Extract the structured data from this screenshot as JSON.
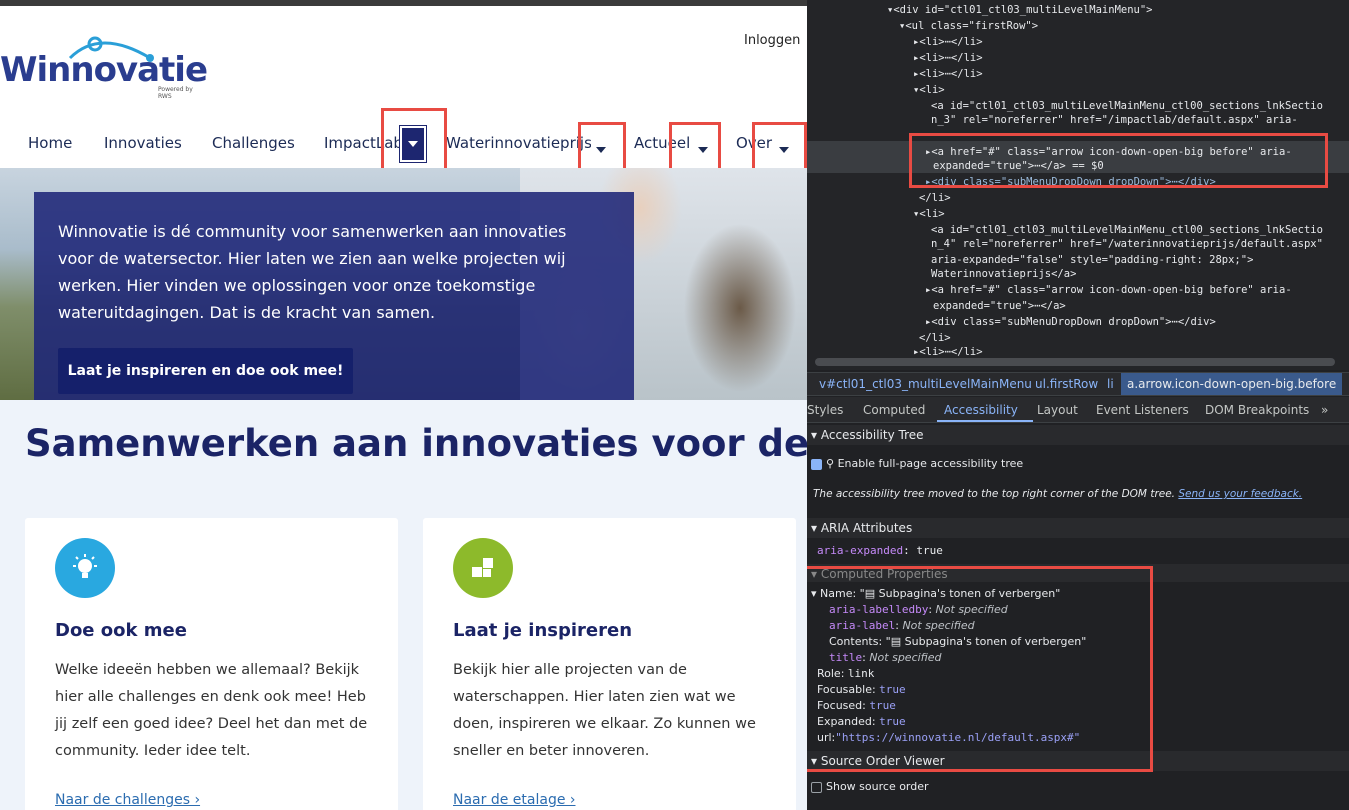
{
  "site": {
    "logo_text": "Winnovatie",
    "logo_sub": "Powered by RWS",
    "login": "Inloggen",
    "nav": [
      "Home",
      "Innovaties",
      "Challenges",
      "ImpactLab",
      "Waterinnovatieprijs",
      "Actueel",
      "Over"
    ],
    "hero_text": "Winnovatie is dé community voor samenwerken aan innovaties voor de watersector. Hier laten we zien aan welke projecten wij werken. Hier vinden we oplossingen voor onze toekomstige wateruitdagingen. Dat is de kracht van samen.",
    "hero_button": "Laat je inspireren en doe ook mee!",
    "headline": "Samenwerken aan innovaties voor de w",
    "cards": [
      {
        "title": "Doe ook mee",
        "text": "Welke ideeën hebben we allemaal? Bekijk hier alle challenges en denk ook mee! Heb jij zelf een goed idee? Deel het dan met de community. Ieder idee telt.",
        "link": "Naar de challenges ›",
        "icon": "lightbulb-icon",
        "color": "#29a8e0"
      },
      {
        "title": "Laat je inspireren",
        "text": "Bekijk hier alle projecten van de waterschappen. Hier laten zien wat we doen, inspireren we elkaar. Zo kunnen we sneller en beter innoveren.",
        "link": "Naar de etalage ›",
        "icon": "puzzle-icon",
        "color": "#8dba2b"
      }
    ]
  },
  "devtools": {
    "dom_lines": [
      {
        "t": "▾<div id=\"ctl01_ctl03_multiLevelMainMenu\">"
      },
      {
        "t": "▾<ul class=\"firstRow\">"
      },
      {
        "t": "▸<li>⋯</li>"
      },
      {
        "t": "▸<li>⋯</li>"
      },
      {
        "t": "▸<li>⋯</li>"
      },
      {
        "t": "▾<li>"
      },
      {
        "t": "<a id=\"ctl01_ctl03_multiLevelMainMenu_ctl00_sections_lnkSectio"
      },
      {
        "t": "n_3\" rel=\"noreferrer\" href=\"/impactlab/default.aspx\" aria-"
      },
      {
        "t": "▸<a href=\"#\" class=\"arrow icon-down-open-big before\" aria-"
      },
      {
        "t": "expanded=\"true\">⋯</a> == $0"
      },
      {
        "t": "▸<div class=\"subMenuDropDown dropDown\">⋯</div>"
      },
      {
        "t": "</li>"
      },
      {
        "t": "▾<li>"
      },
      {
        "t": "<a id=\"ctl01_ctl03_multiLevelMainMenu_ctl00_sections_lnkSectio"
      },
      {
        "t": "n_4\" rel=\"noreferrer\" href=\"/waterinnovatieprijs/default.aspx\""
      },
      {
        "t": "aria-expanded=\"false\" style=\"padding-right: 28px;\">"
      },
      {
        "t": "Waterinnovatieprijs</a>"
      },
      {
        "t": "▸<a href=\"#\" class=\"arrow icon-down-open-big before\" aria-"
      },
      {
        "t": "expanded=\"true\">⋯</a>"
      },
      {
        "t": "▸<div class=\"subMenuDropDown dropDown\">⋯</div>"
      },
      {
        "t": "</li>"
      },
      {
        "t": "▸<li>⋯</li>"
      }
    ],
    "breadcrumbs": [
      "v#ctl01_ctl03_multiLevelMainMenu",
      "ul.firstRow",
      "li",
      "a.arrow.icon-down-open-big.before"
    ],
    "tabs": [
      "Styles",
      "Computed",
      "Accessibility",
      "Layout",
      "Event Listeners",
      "DOM Breakpoints",
      "»"
    ],
    "active_tab": "Accessibility",
    "acc_tree_header": "Accessibility Tree",
    "enable_tree": "Enable full-page accessibility tree",
    "moved_note": "The accessibility tree moved to the top right corner of the DOM tree.",
    "feedback_link": "Send us your feedback.",
    "aria_header": "ARIA Attributes",
    "aria_expanded_key": "aria-expanded",
    "aria_expanded_val": "true",
    "computed_header": "Computed Properties",
    "name_line": "Name: \"▤ Subpagina's tonen of verbergen\"",
    "labelledby": "aria-labelledby",
    "labelledby_val": "Not specified",
    "arialabel": "aria-label",
    "arialabel_val": "Not specified",
    "contents": "Contents: \"▤ Subpagina's tonen of verbergen\"",
    "title_key": "title",
    "title_val": "Not specified",
    "role_key": "Role:",
    "role_val": "link",
    "focusable_key": "Focusable:",
    "focusable_val": "true",
    "focused_key": "Focused:",
    "focused_val": "true",
    "expanded_key": "Expanded:",
    "expanded_val": "true",
    "url_key": "url:",
    "url_val": "\"https://winnovatie.nl/default.aspx#\"",
    "source_header": "Source Order Viewer",
    "show_source": "Show source order"
  }
}
